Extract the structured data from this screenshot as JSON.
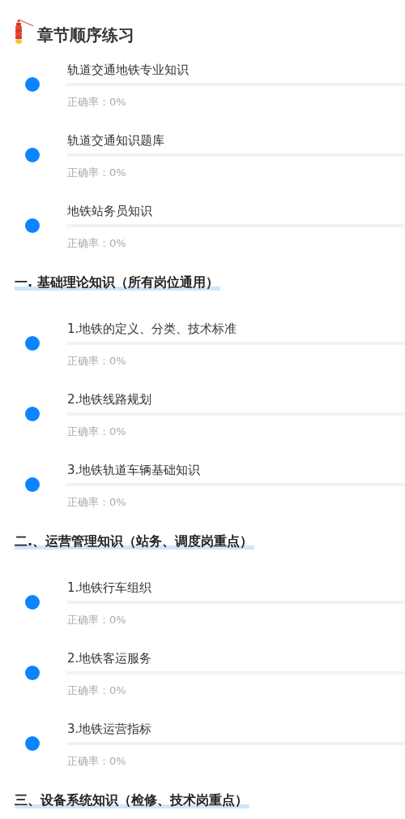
{
  "page_title": "章节顺序练习",
  "sections": [
    {
      "items": [
        {
          "title": "轨道交通地铁专业知识",
          "level": 0,
          "accuracy": "正确率：0%"
        },
        {
          "title": "轨道交通知识题库",
          "level": 0,
          "accuracy": "正确率：0%"
        },
        {
          "title": "地铁站务员知识",
          "level": 0,
          "accuracy": "正确率：0%"
        }
      ]
    },
    {
      "heading": "一. 基础理论知识（所有岗位通用）",
      "items": [
        {
          "title": "1.地铁的定义、分类、技术标准",
          "level": 0,
          "accuracy": "正确率：0%"
        },
        {
          "title": "2.地铁线路规划",
          "level": 0,
          "accuracy": "正确率：0%"
        },
        {
          "title": "3.地铁轨道车辆基础知识",
          "level": 0,
          "accuracy": "正确率：0%"
        }
      ]
    },
    {
      "heading": "二.、运营管理知识（站务、调度岗重点）",
      "items": [
        {
          "title": "1.地铁行车组织",
          "level": 0,
          "accuracy": "正确率：0%"
        },
        {
          "title": "2.地铁客运服务",
          "level": 0,
          "accuracy": "正确率：0%"
        },
        {
          "title": "3.地铁运营指标",
          "level": 0,
          "accuracy": "正确率：0%"
        }
      ]
    },
    {
      "heading": "三、设备系统知识（检修、技术岗重点）"
    }
  ]
}
